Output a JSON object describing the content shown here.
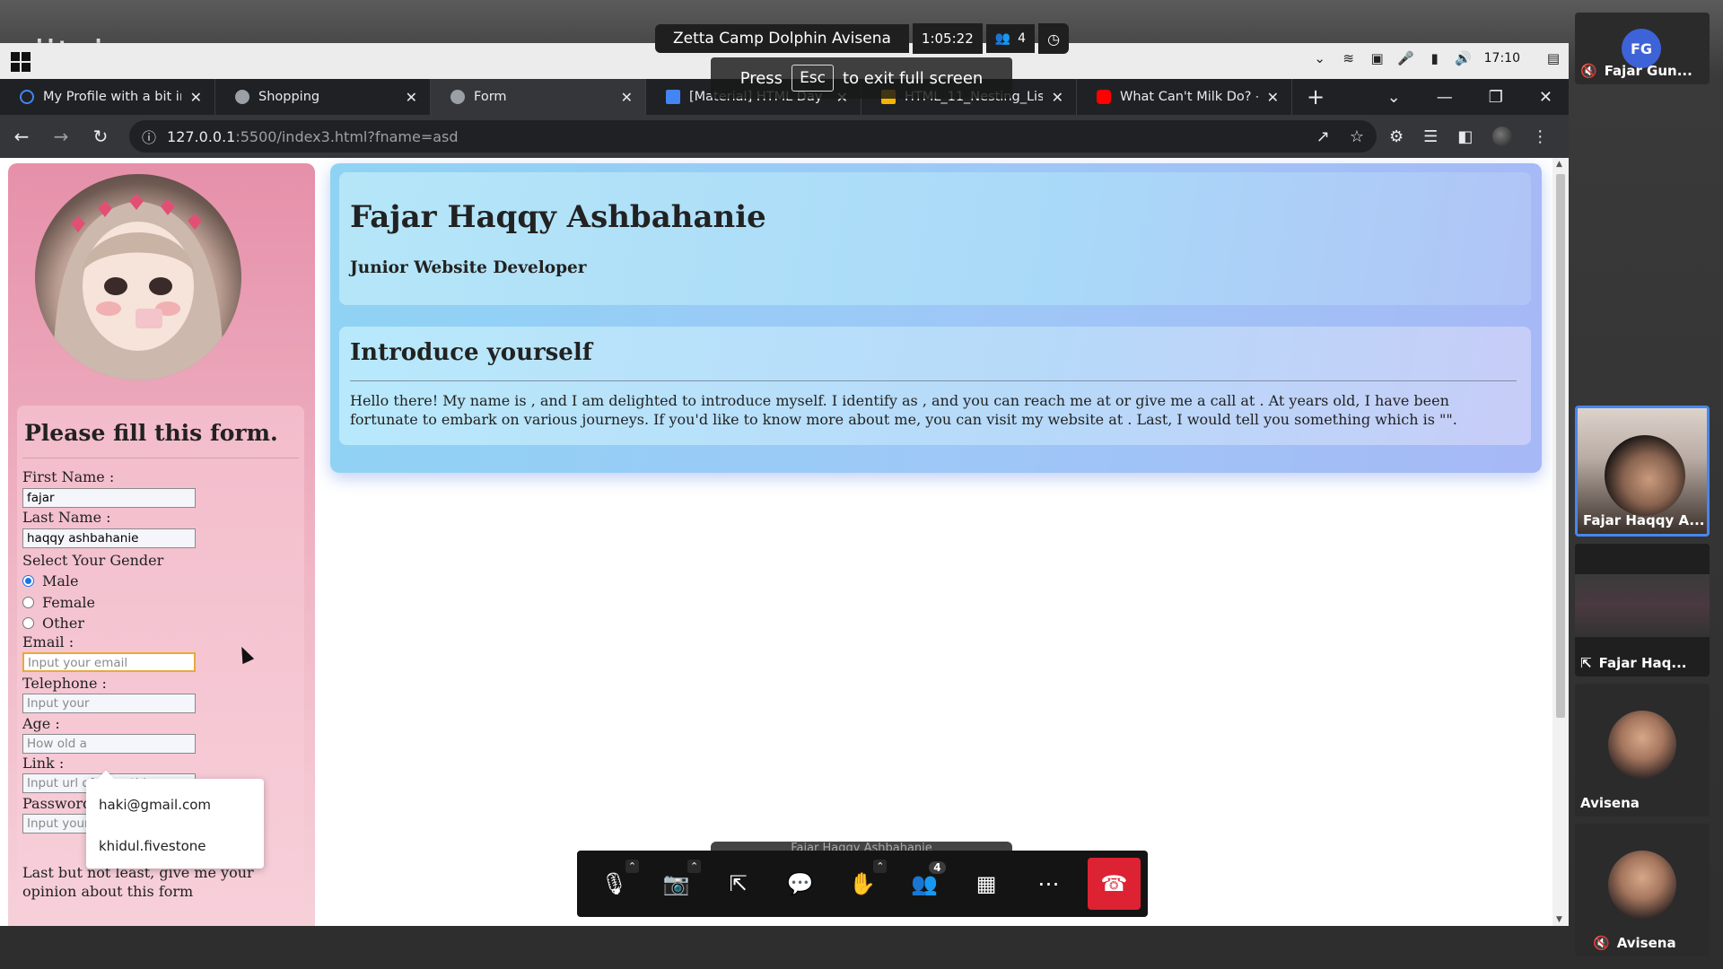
{
  "meeting": {
    "logo": "jitsi",
    "room_name": "Zetta Camp Dolphin Avisena",
    "duration": "1:05:22",
    "participants_count": "4",
    "esc_hint_prefix": "Press",
    "esc_hint_key": "Esc",
    "esc_hint_suffix": "to exit full screen",
    "participants_badge": "4"
  },
  "system_tray": {
    "clock": "17:10"
  },
  "browser": {
    "tabs": [
      {
        "title": "My Profile with a bit in",
        "favicon_color": "#4285f4",
        "icon": "loading-icon"
      },
      {
        "title": "Shopping",
        "favicon_color": "#9aa0a6",
        "icon": "globe-icon"
      },
      {
        "title": "Form",
        "favicon_color": "#9aa0a6",
        "icon": "globe-icon"
      },
      {
        "title": "[Material] HTML Day",
        "favicon_color": "#4285f4",
        "icon": "docs-icon"
      },
      {
        "title": "HTML_11_Nesting_List",
        "favicon_color": "#f4b400",
        "icon": "drive-icon"
      },
      {
        "title": "What Can't Milk Do? -",
        "favicon_color": "#ff0000",
        "icon": "youtube-icon"
      }
    ],
    "url_host": "127.0.0.1",
    "url_path": ":5500/index3.html?fname=asd"
  },
  "page": {
    "name": "Fajar Haqqy Ashbahanie",
    "role": "Junior Website Developer",
    "intro_heading": "Introduce yourself",
    "intro_text": "Hello there! My name is , and I am delighted to introduce myself. I identify as , and you can reach me at or give me a call at . At years old, I have been fortunate to embark on various journeys. If you'd like to know more about me, you can visit my website at . Last, I would tell you something which is \"\".",
    "form": {
      "heading": "Please fill this form.",
      "first_name_label": "First Name :",
      "first_name_value": "fajar",
      "last_name_label": "Last Name :",
      "last_name_value": "haqqy ashbahanie",
      "gender_label": "Select Your Gender",
      "gender_options": [
        "Male",
        "Female",
        "Other"
      ],
      "gender_selected": "Male",
      "email_label": "Email :",
      "email_placeholder": "Input your email",
      "telephone_label": "Telephone :",
      "telephone_placeholder": "Input your",
      "age_label": "Age :",
      "age_placeholder": "How old a",
      "link_label": "Link :",
      "link_placeholder": "Input url of something",
      "password_label": "Password :",
      "password_placeholder": "Input your password",
      "opinion_text": "Last but not least, give me your opinion about this form"
    },
    "autofill": [
      "haki@gmail.com",
      "khidul.fivestone"
    ]
  },
  "ghost_label": "Fajar Haqqy Ashbahanie",
  "filmstrip": [
    {
      "label": "Fajar Gun...",
      "initials": "FG",
      "muted": true
    },
    {
      "label": "Fajar Haqqy A...",
      "active": true
    },
    {
      "label": "Fajar Haq...",
      "screenshare": true
    },
    {
      "label": "Avisena"
    },
    {
      "label": "Avisena",
      "muted": true
    }
  ]
}
